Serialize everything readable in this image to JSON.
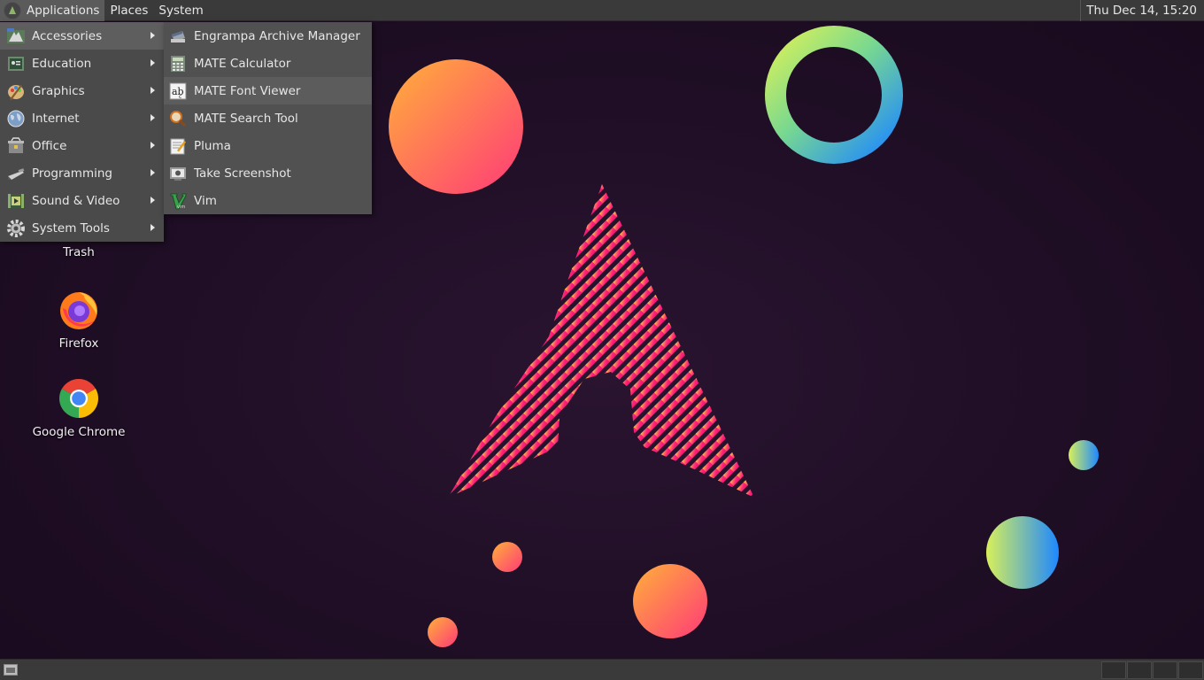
{
  "top_panel": {
    "menus": [
      {
        "label": "Applications"
      },
      {
        "label": "Places"
      },
      {
        "label": "System"
      }
    ],
    "clock": "Thu Dec 14, 15:20"
  },
  "applications_menu": {
    "categories": [
      {
        "label": "Accessories",
        "icon": "accessories-icon"
      },
      {
        "label": "Education",
        "icon": "education-icon"
      },
      {
        "label": "Graphics",
        "icon": "graphics-icon"
      },
      {
        "label": "Internet",
        "icon": "internet-icon"
      },
      {
        "label": "Office",
        "icon": "office-icon"
      },
      {
        "label": "Programming",
        "icon": "programming-icon"
      },
      {
        "label": "Sound & Video",
        "icon": "sound-video-icon"
      },
      {
        "label": "System Tools",
        "icon": "system-tools-icon"
      }
    ],
    "highlighted_category": "Accessories"
  },
  "accessories_submenu": {
    "items": [
      {
        "label": "Engrampa Archive Manager",
        "icon": "archive-manager-icon"
      },
      {
        "label": "MATE Calculator",
        "icon": "calculator-icon"
      },
      {
        "label": "MATE Font Viewer",
        "icon": "font-viewer-icon"
      },
      {
        "label": "MATE Search Tool",
        "icon": "search-tool-icon"
      },
      {
        "label": "Pluma",
        "icon": "text-editor-icon"
      },
      {
        "label": "Take Screenshot",
        "icon": "screenshot-icon"
      },
      {
        "label": "Vim",
        "icon": "vim-icon"
      }
    ]
  },
  "desktop_icons": [
    {
      "label": "Trash",
      "icon": "trash-icon"
    },
    {
      "label": "Firefox",
      "icon": "firefox-icon"
    },
    {
      "label": "Google Chrome",
      "icon": "chrome-icon"
    }
  ],
  "colors": {
    "panel_bg": "#3a3a3a",
    "menu_bg": "#4a4a4a",
    "submenu_bg": "#515151",
    "desktop_bg": "#1f0e25",
    "accent_pink": "#ff1f7a",
    "accent_orange": "#ffa040"
  }
}
